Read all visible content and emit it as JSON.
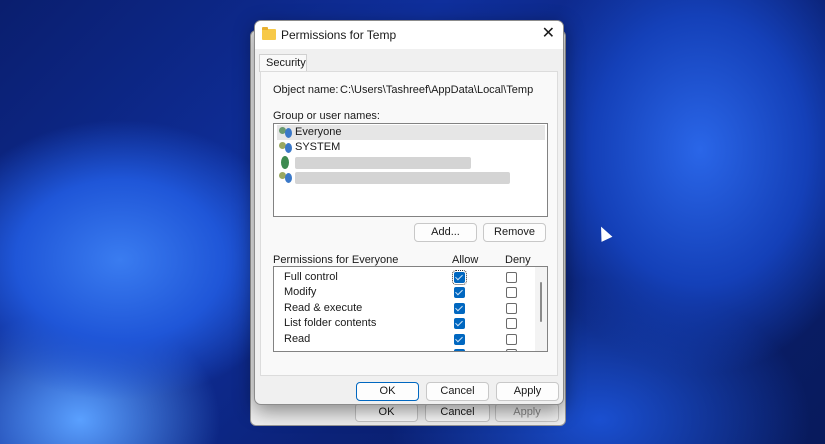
{
  "background_window": {
    "ok": "OK",
    "cancel": "Cancel",
    "apply": "Apply"
  },
  "dialog": {
    "title": "Permissions for Temp",
    "tab": "Security",
    "object_name_label": "Object name:",
    "object_name_value": "C:\\Users\\Tashreef\\AppData\\Local\\Temp",
    "group_label": "Group or user names:",
    "users": [
      {
        "name": "Everyone",
        "selected": true
      },
      {
        "name": "SYSTEM",
        "selected": false
      },
      {
        "name": "",
        "redacted": true
      },
      {
        "name": "",
        "redacted": true
      }
    ],
    "add_button": "Add...",
    "remove_button": "Remove",
    "permissions_label": "Permissions for Everyone",
    "allow_header": "Allow",
    "deny_header": "Deny",
    "permissions": [
      {
        "name": "Full control",
        "allow": true,
        "deny": false
      },
      {
        "name": "Modify",
        "allow": true,
        "deny": false
      },
      {
        "name": "Read & execute",
        "allow": true,
        "deny": false
      },
      {
        "name": "List folder contents",
        "allow": true,
        "deny": false
      },
      {
        "name": "Read",
        "allow": true,
        "deny": false
      }
    ],
    "ok": "OK",
    "cancel": "Cancel",
    "apply": "Apply"
  },
  "colors": {
    "accent": "#0067c0"
  }
}
